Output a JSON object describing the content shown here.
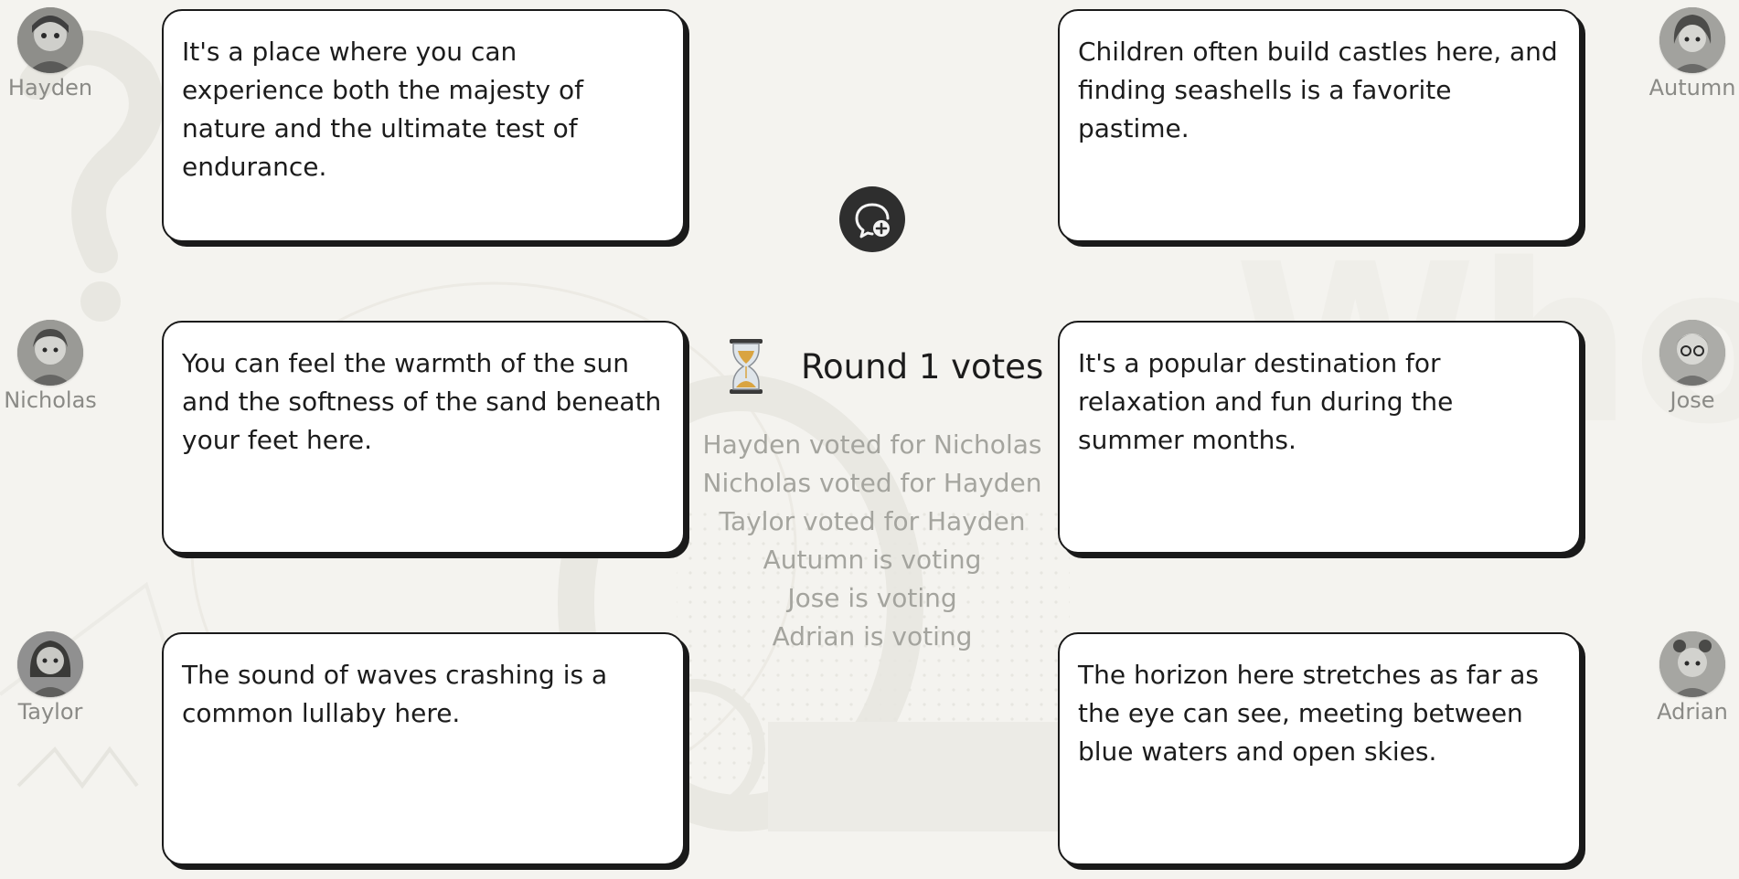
{
  "players": [
    {
      "name": "Hayden",
      "side": "left",
      "row": 0,
      "hint": "It's a place where you can experience both the majesty of nature and the ultimate test of endurance.",
      "avatar_icon": "hayden-avatar-icon"
    },
    {
      "name": "Nicholas",
      "side": "left",
      "row": 1,
      "hint": "You can feel the warmth of the sun and the softness of the sand beneath your feet here.",
      "avatar_icon": "nicholas-avatar-icon"
    },
    {
      "name": "Taylor",
      "side": "left",
      "row": 2,
      "hint": "The sound of waves crashing is a common lullaby here.",
      "avatar_icon": "taylor-avatar-icon"
    },
    {
      "name": "Autumn",
      "side": "right",
      "row": 0,
      "hint": "Children often build castles here, and finding seashells is a favorite pastime.",
      "avatar_icon": "autumn-avatar-icon"
    },
    {
      "name": "Jose",
      "side": "right",
      "row": 1,
      "hint": "It's a popular destination for relaxation and fun during the summer months.",
      "avatar_icon": "jose-avatar-icon"
    },
    {
      "name": "Adrian",
      "side": "right",
      "row": 2,
      "hint": "The horizon here stretches as far as the eye can see, meeting between blue waters and open skies.",
      "avatar_icon": "adrian-avatar-icon"
    }
  ],
  "round": {
    "title": "Round 1 votes",
    "icon": "hourglass-icon",
    "votes": [
      "Hayden voted for Nicholas",
      "Nicholas voted for Hayden",
      "Taylor voted for Hayden",
      "Autumn is voting",
      "Jose is voting",
      "Adrian is voting"
    ]
  },
  "actions": {
    "add_chat_icon": "chat-bubble-plus-icon"
  },
  "colors": {
    "background": "#f4f3ef",
    "card_border": "#1a1a1a",
    "vote_text": "#a4a49e",
    "player_name": "#8a8a86"
  }
}
